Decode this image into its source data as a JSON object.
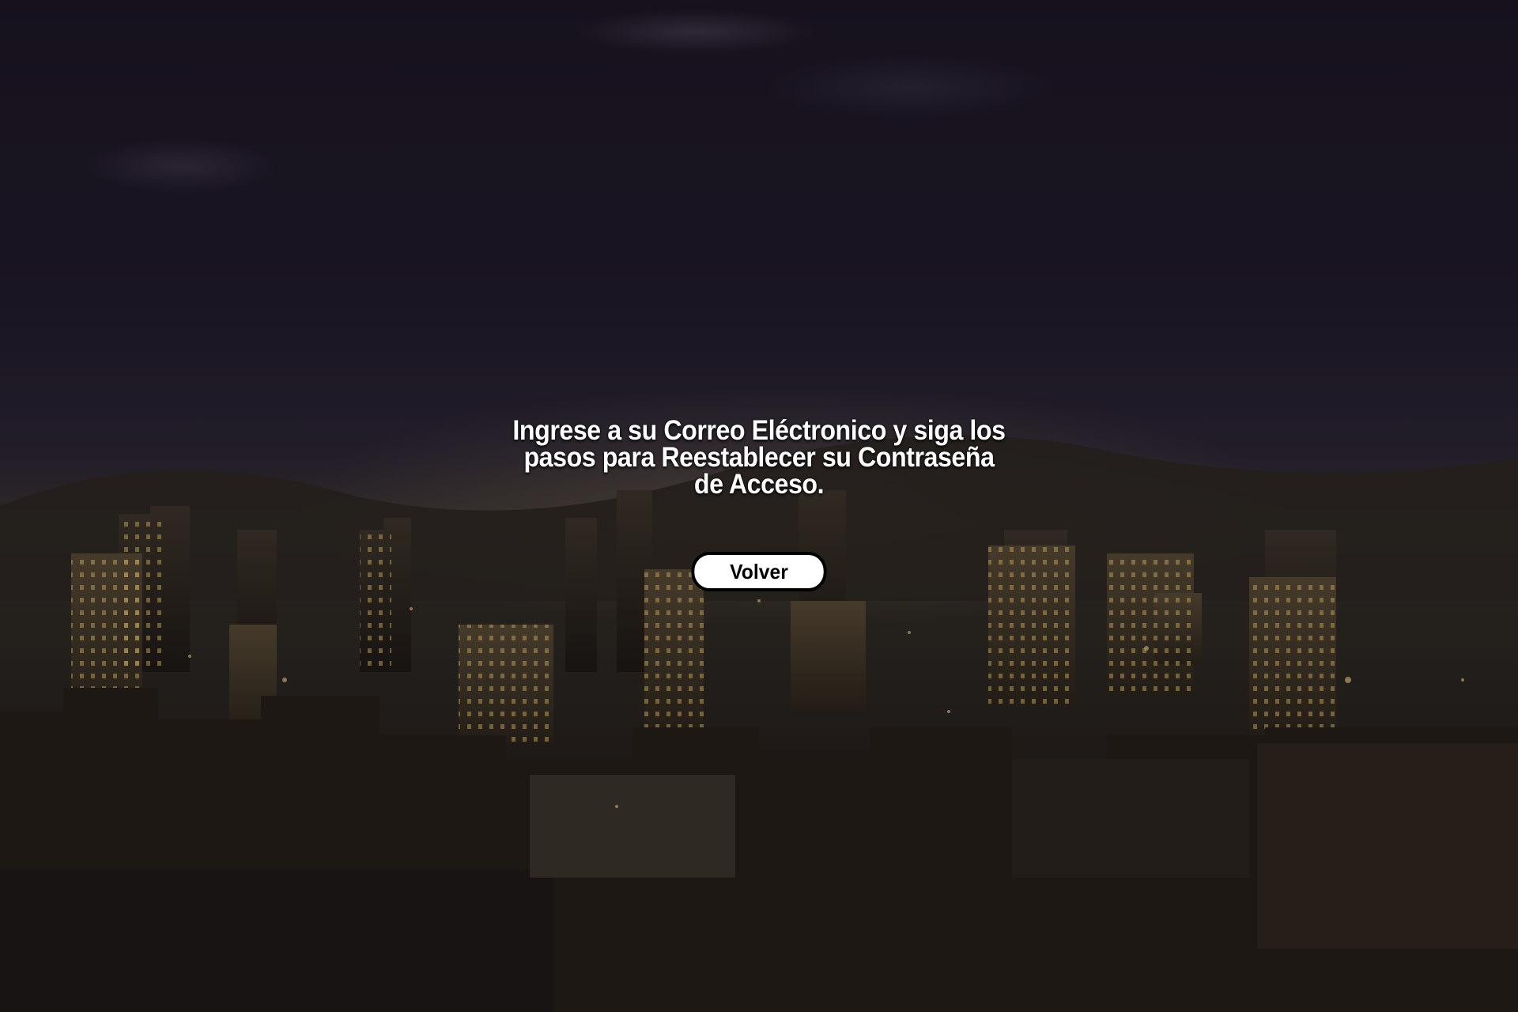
{
  "reset_notice": {
    "message": "Ingrese a su Correo Eléctronico y siga los pasos para Reestablecer su Contraseña de Acceso.",
    "back_button_label": "Volver"
  },
  "colors": {
    "text": "#ffffff",
    "button_background": "#ffffff",
    "button_text": "#000000",
    "button_border": "#000000"
  },
  "background_image": "night-city-skyline"
}
